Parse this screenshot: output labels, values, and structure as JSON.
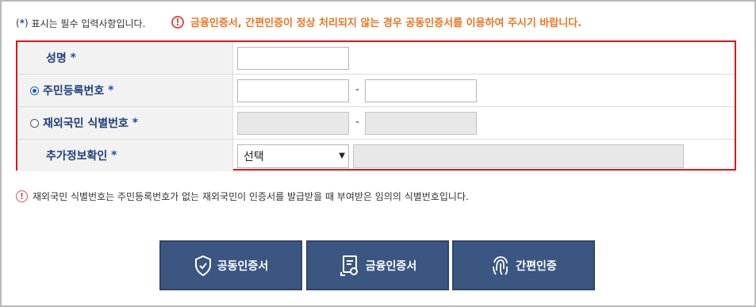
{
  "notes": {
    "required_prefix": "(",
    "required_star": "*",
    "required_suffix": ")",
    "required_text": "표시는 필수 입력사항입니다.",
    "warning_mark": "!",
    "warning_text": "금융인증서, 간편인증이 정상 처리되지 않는 경우 공동인증서를 이용하여 주시기 바랍니다.",
    "footer_text": "재외국민 식별번호는 주민등록번호가 없는 재외국민이 인증서를 발급받을 때 부여받은 임의의 식별번호입니다."
  },
  "form": {
    "name_label": "성명",
    "rrn_label": "주민등록번호",
    "foreign_label": "재외국민 식별번호",
    "extra_label": "추가정보확인",
    "star": "*",
    "dash": "-",
    "select_value": "선택",
    "select_arrow": "▼",
    "rrn_selected": true,
    "foreign_selected": false
  },
  "buttons": {
    "joint_cert": "공동인증서",
    "financial_cert": "금융인증서",
    "simple_auth": "간편인증"
  },
  "colors": {
    "accent_red": "#e3111a",
    "warning_orange": "#e87722",
    "label_blue": "#1f3f7a",
    "button_navy": "#3b5681"
  },
  "icons": {
    "joint_cert": "shield-check-icon",
    "financial_cert": "certificate-icon",
    "simple_auth": "fingerprint-icon",
    "warning": "exclamation-circle-icon"
  }
}
